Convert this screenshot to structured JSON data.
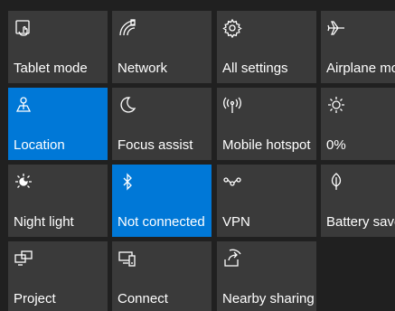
{
  "tiles": [
    {
      "label": "Tablet mode",
      "icon": "tablet-mode-icon",
      "active": false
    },
    {
      "label": "Network",
      "icon": "network-icon",
      "active": false
    },
    {
      "label": "All settings",
      "icon": "gear-icon",
      "active": false
    },
    {
      "label": "Airplane mo",
      "icon": "airplane-icon",
      "active": false
    },
    {
      "label": "Location",
      "icon": "location-icon",
      "active": true
    },
    {
      "label": "Focus assist",
      "icon": "moon-icon",
      "active": false
    },
    {
      "label": "Mobile hotspot",
      "icon": "hotspot-icon",
      "active": false
    },
    {
      "label": "0%",
      "icon": "brightness-icon",
      "active": false
    },
    {
      "label": "Night light",
      "icon": "night-light-icon",
      "active": false
    },
    {
      "label": "Not connected",
      "icon": "bluetooth-icon",
      "active": true
    },
    {
      "label": "VPN",
      "icon": "vpn-icon",
      "active": false
    },
    {
      "label": "Battery save",
      "icon": "battery-saver-icon",
      "active": false
    },
    {
      "label": "Project",
      "icon": "project-icon",
      "active": false
    },
    {
      "label": "Connect",
      "icon": "connect-icon",
      "active": false
    },
    {
      "label": "Nearby sharing",
      "icon": "nearby-sharing-icon",
      "active": false
    }
  ],
  "colors": {
    "tile_bg": "#3a3a3a",
    "active_bg": "#0078d7",
    "panel_bg": "#202020",
    "text": "#ffffff"
  }
}
